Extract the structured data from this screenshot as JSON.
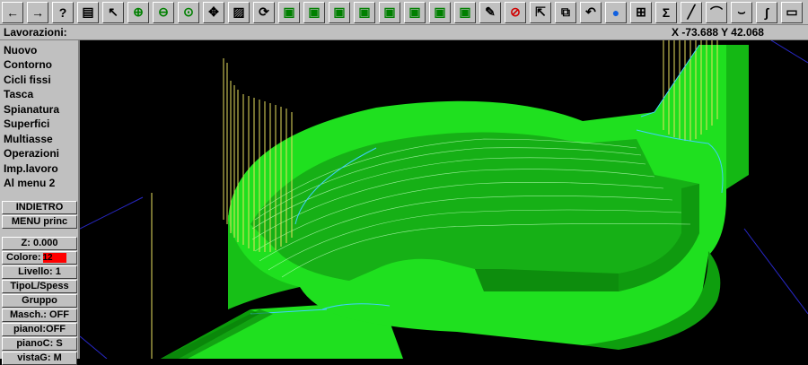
{
  "toolbar": {
    "items": [
      {
        "name": "arrow-left-icon",
        "glyph": "←"
      },
      {
        "name": "arrow-right-icon",
        "glyph": "→"
      },
      {
        "name": "help-icon",
        "glyph": "?"
      },
      {
        "name": "calculator-icon",
        "glyph": "▤"
      },
      {
        "name": "select-tool-icon",
        "glyph": "↖"
      },
      {
        "name": "zoom-in-icon",
        "glyph": "⊕"
      },
      {
        "name": "zoom-out-icon",
        "glyph": "⊖"
      },
      {
        "name": "zoom-window-icon",
        "glyph": "⊙"
      },
      {
        "name": "pan-icon",
        "glyph": "✥"
      },
      {
        "name": "zoom-fit-icon",
        "glyph": "▨"
      },
      {
        "name": "rotate-view-icon",
        "glyph": "⟳"
      },
      {
        "name": "cube-view-1-icon",
        "glyph": "▣"
      },
      {
        "name": "cube-view-2-icon",
        "glyph": "▣"
      },
      {
        "name": "cube-view-3-icon",
        "glyph": "▣"
      },
      {
        "name": "cube-view-4-icon",
        "glyph": "▣"
      },
      {
        "name": "cube-view-5-icon",
        "glyph": "▣"
      },
      {
        "name": "cube-view-6-icon",
        "glyph": "▣"
      },
      {
        "name": "cube-view-7-icon",
        "glyph": "▣"
      },
      {
        "name": "cube-view-8-icon",
        "glyph": "▣"
      },
      {
        "name": "pencil-icon",
        "glyph": "✎"
      },
      {
        "name": "cancel-icon",
        "glyph": "⊘"
      },
      {
        "name": "move-icon",
        "glyph": "⇱"
      },
      {
        "name": "copy-icon",
        "glyph": "⧉"
      },
      {
        "name": "undo-icon",
        "glyph": "↶"
      },
      {
        "name": "sphere-icon",
        "glyph": "●"
      },
      {
        "name": "layers-icon",
        "glyph": "⊞"
      },
      {
        "name": "sum-icon",
        "glyph": "Σ"
      },
      {
        "name": "line-icon",
        "glyph": "╱"
      },
      {
        "name": "arc-icon",
        "glyph": "⌒"
      },
      {
        "name": "curve-icon",
        "glyph": "⌣"
      },
      {
        "name": "spline-icon",
        "glyph": "∫"
      },
      {
        "name": "rectangle-icon",
        "glyph": "▭"
      }
    ]
  },
  "status": {
    "title": "Lavorazioni:",
    "coords": "X -73.688  Y 42.068"
  },
  "sidebar": {
    "menu": [
      {
        "label": "Nuovo"
      },
      {
        "label": "Contorno"
      },
      {
        "label": "Cicli fissi"
      },
      {
        "label": "Tasca"
      },
      {
        "label": "Spianatura"
      },
      {
        "label": "Superfici"
      },
      {
        "label": "Multiasse"
      },
      {
        "label": "Operazioni"
      },
      {
        "label": "Imp.lavoro"
      },
      {
        "label": "Al menu 2"
      }
    ],
    "nav_buttons": [
      "INDIETRO",
      "MENU princ"
    ],
    "params": [
      {
        "label": "Z:  0.000"
      },
      {
        "label": "Colore:",
        "value": "12",
        "color": "#ff0000"
      },
      {
        "label": "Livello:  1"
      },
      {
        "label": "TipoL/Spess"
      },
      {
        "label": "Gruppo"
      },
      {
        "label": "Masch.: OFF"
      },
      {
        "label": "pianoI:OFF"
      },
      {
        "label": "pianoC:  S"
      },
      {
        "label": "vistaG:  M"
      }
    ]
  },
  "colors": {
    "part": "#1fe01f",
    "part_dark": "#0a8a0a",
    "toolpath_yellow": "#e8e060",
    "toolpath_cyan": "#40d0ff",
    "axis_blue": "#2828c8"
  }
}
